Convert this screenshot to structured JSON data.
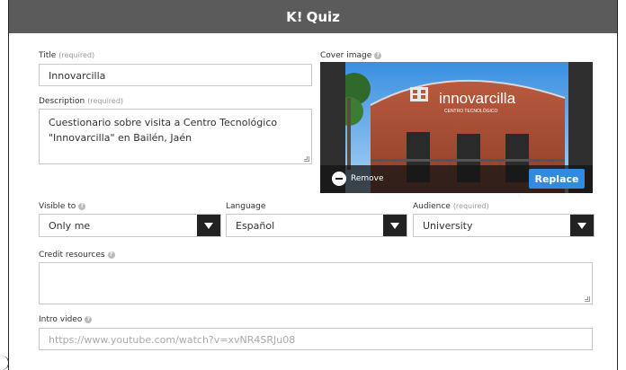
{
  "header": {
    "logo": "K!",
    "title": "Quiz"
  },
  "form": {
    "title_label": "Title",
    "title_required": "(required)",
    "title_value": "Innovarcilla",
    "description_label": "Description",
    "description_required": "(required)",
    "description_line1": "Cuestionario sobre visita a Centro Tecnológico",
    "description_line2": "\"Innovarcilla\" en Bailén, Jaén",
    "cover_label": "Cover image",
    "cover_remove": "Remove",
    "cover_replace": "Replace",
    "cover_sign_brand": "innovarcilla",
    "cover_sign_sub": "CENTRO TECNOLÓGICO",
    "visible_label": "Visible to",
    "visible_value": "Only me",
    "language_label": "Language",
    "language_value": "Español",
    "audience_label": "Audience",
    "audience_required": "(required)",
    "audience_value": "University",
    "credit_label": "Credit resources",
    "intro_label": "Intro video",
    "intro_placeholder": "https://www.youtube.com/watch?v=xvNR4SRJu08"
  },
  "colors": {
    "header_bg": "#5b5b5b",
    "replace_btn": "#2f8ae0",
    "select_arrow_bg": "#222222"
  },
  "icons": {
    "help": "help-circle-icon",
    "remove": "minus-circle-icon",
    "select": "chevron-down-icon"
  }
}
